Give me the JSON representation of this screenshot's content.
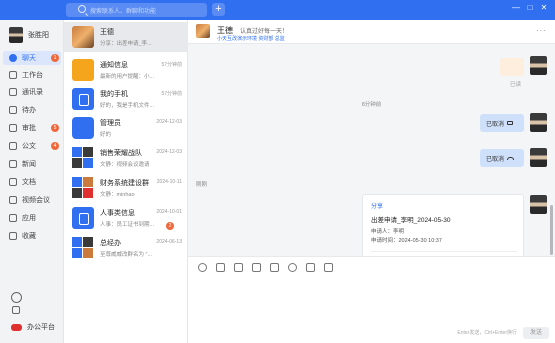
{
  "topbar": {
    "search_placeholder": "搜索联系人、群聊和功能",
    "add_label": "+",
    "min": "—",
    "max": "□",
    "close": "✕"
  },
  "user": {
    "name": "张胜阳"
  },
  "nav": {
    "items": [
      {
        "label": "聊天",
        "badge": "1"
      },
      {
        "label": "工作台",
        "badge": ""
      },
      {
        "label": "通讯录",
        "badge": ""
      },
      {
        "label": "待办",
        "badge": ""
      },
      {
        "label": "审批",
        "badge": "5"
      },
      {
        "label": "公文",
        "badge": "4"
      },
      {
        "label": "新闻",
        "badge": ""
      },
      {
        "label": "文档",
        "badge": ""
      },
      {
        "label": "视频会议",
        "badge": ""
      },
      {
        "label": "应用",
        "badge": ""
      },
      {
        "label": "收藏",
        "badge": ""
      }
    ],
    "office_label": "办公平台"
  },
  "conversations": [
    {
      "name": "王德",
      "time": "",
      "preview": "分享：出差申请_李...",
      "badge": ""
    },
    {
      "name": "通知信息",
      "time": "57分钟前",
      "preview": "最新的用户提醒：小...",
      "badge": ""
    },
    {
      "name": "我的手机",
      "time": "57分钟前",
      "preview": "好的，我是手机文件...",
      "badge": ""
    },
    {
      "name": "管理员",
      "time": "2024-12-03",
      "preview": "好的",
      "badge": ""
    },
    {
      "name": "销售荣耀战队",
      "time": "2024-12-03",
      "preview": "文静：视频会议邀请",
      "badge": ""
    },
    {
      "name": "财务系统建设群",
      "time": "2024-10-11",
      "preview": "文静：minhao",
      "badge": ""
    },
    {
      "name": "人事类信息",
      "time": "2024-10-01",
      "preview": "人事：员工证书到期...",
      "badge": "2"
    },
    {
      "name": "总经办",
      "time": "2024-06-13",
      "preview": "至尊威威改群名为 \"...",
      "badge": ""
    }
  ],
  "chat": {
    "header": {
      "name": "王德",
      "signature": "认真过好每一天！",
      "sub": "小天互改演示环境  资财部  总监"
    },
    "more_label": "···",
    "read1": "已读",
    "time_sep1": "8分钟前",
    "bubble1": "已取消",
    "bubble2": "已取消",
    "time_sep2": "刚刚",
    "card": {
      "tag": "分享",
      "title": "出差申请_李明_2024-05-30",
      "applicant": "申请人：李明",
      "apply_time": "申请时间：2024-05-30 10:37",
      "link": "点击查看详情>>"
    },
    "unread": "未读",
    "hint": "Enter发送，Ctrl+Enter换行",
    "send_label": "发送"
  }
}
